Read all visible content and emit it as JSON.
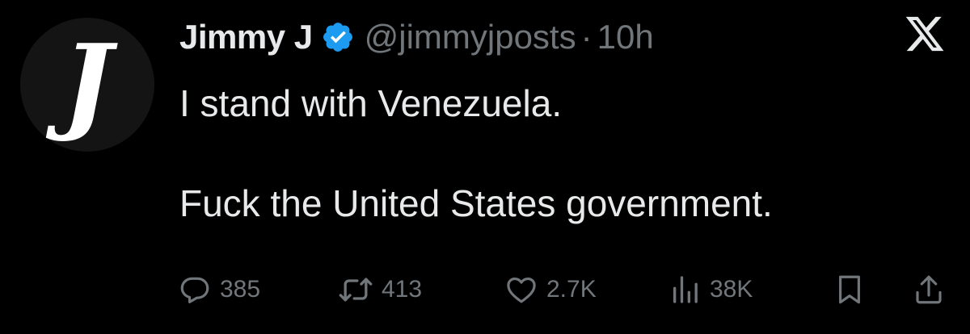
{
  "tweet": {
    "avatar_letter": "J",
    "display_name": "Jimmy J",
    "handle": "@jimmyjposts",
    "separator": "·",
    "time": "10h",
    "text_lines": [
      "I stand with Venezuela.",
      "Fuck the United States government."
    ],
    "icons": {
      "verified": "verified-badge-icon",
      "platform": "x-logo-icon",
      "reply": "reply-icon",
      "retweet": "retweet-icon",
      "like": "heart-icon",
      "views": "views-icon",
      "bookmark": "bookmark-icon",
      "share": "share-icon"
    },
    "stats": {
      "replies": "385",
      "retweets": "413",
      "likes": "2.7K",
      "views": "38K"
    }
  },
  "colors": {
    "background": "#000000",
    "text": "#e7e9ea",
    "muted": "#71767b",
    "verified": "#1d9bf0"
  }
}
